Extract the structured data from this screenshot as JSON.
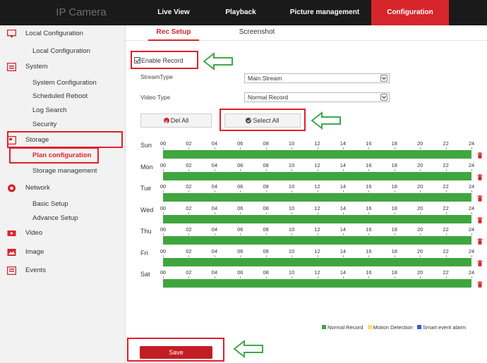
{
  "app": {
    "title": "IP Camera"
  },
  "nav": [
    {
      "label": "Live View"
    },
    {
      "label": "Playback"
    },
    {
      "label": "Picture management"
    },
    {
      "label": "Configuration"
    }
  ],
  "sidebar": {
    "local_configuration": "Local Configuration",
    "local_configuration_sub": "Local Configuration",
    "system": "System",
    "system_configuration": "System Configuration",
    "scheduled_reboot": "Scheduled Reboot",
    "log_search": "Log Search",
    "security": "Security",
    "storage": "Storage",
    "plan_configuration": "Plan configuration",
    "storage_management": "Storage management",
    "network": "Network",
    "basic_setup": "Basic Setup",
    "advance_setup": "Advance Setup",
    "video": "Video",
    "image": "Image",
    "events": "Events"
  },
  "tabs": {
    "rec_setup": "Rec Setup",
    "screenshot": "Screenshot"
  },
  "form": {
    "enable_record": "Enable Record",
    "enable_record_checked": true,
    "stream_type_label": "StreamType",
    "stream_type_value": "Main Stream",
    "video_type_label": "Video Type",
    "video_type_value": "Normal Record"
  },
  "buttons": {
    "del_all": "Del All",
    "select_all": "Select All",
    "save": "Save"
  },
  "schedule": {
    "days": [
      "Sun",
      "Mon",
      "Tue",
      "Wed",
      "Thu",
      "Fri",
      "Sat"
    ],
    "hours": [
      "00",
      "02",
      "04",
      "06",
      "08",
      "10",
      "12",
      "14",
      "16",
      "18",
      "20",
      "22",
      "24"
    ],
    "recorded_fraction": 1.0
  },
  "legend": [
    {
      "label": "Normal Record",
      "color": "#3fa63f"
    },
    {
      "label": "Motion Detection",
      "color": "#f3e36b"
    },
    {
      "label": "Smart event alarm",
      "color": "#2f5fd0"
    }
  ],
  "colors": {
    "accent": "#d7252c",
    "highlight": "#e0202a",
    "arrow": "#3ea84a"
  }
}
